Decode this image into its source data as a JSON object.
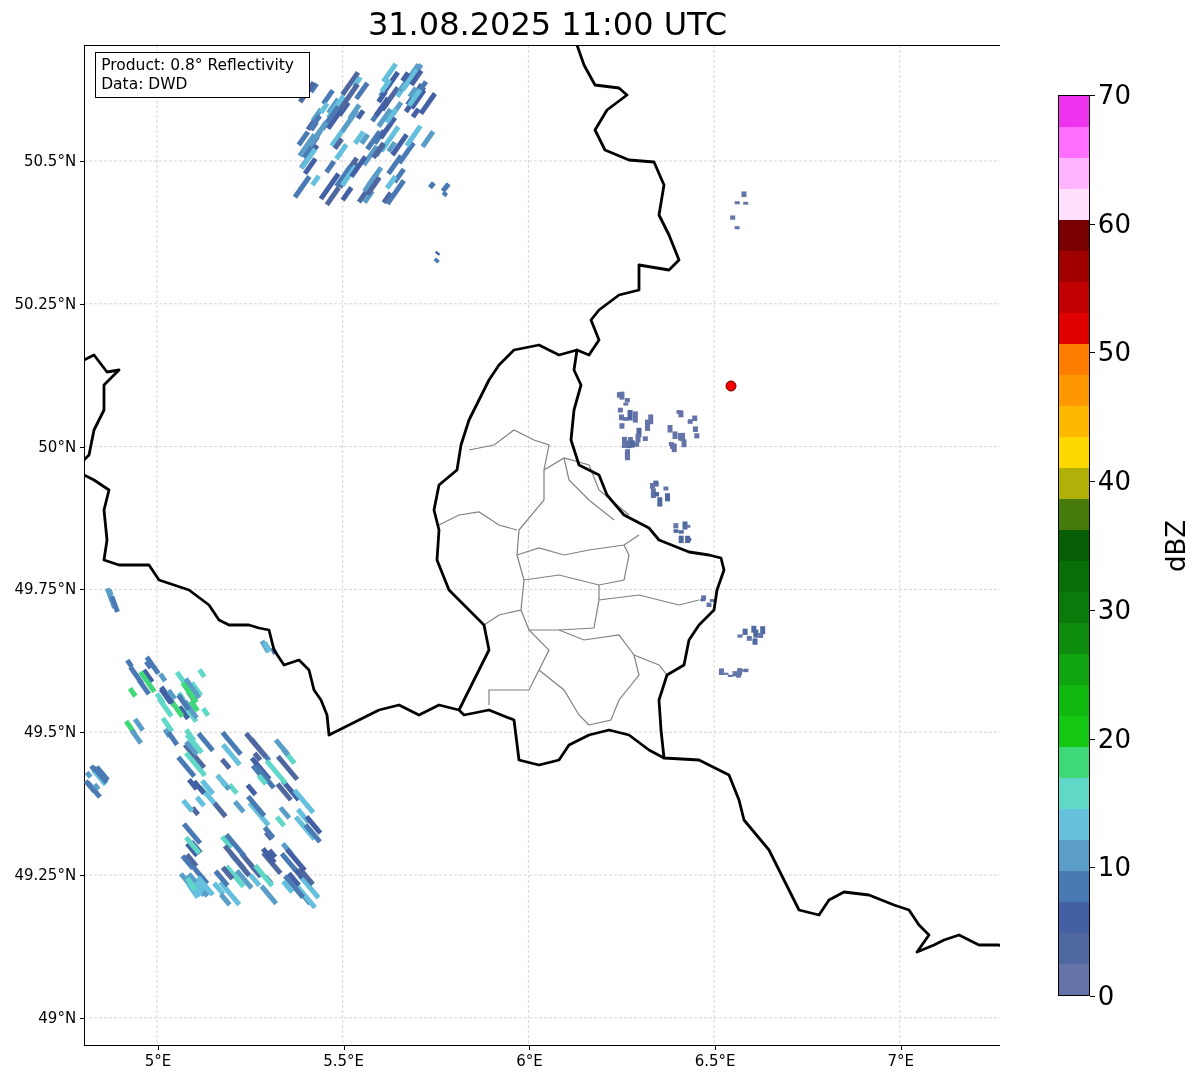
{
  "title": "31.08.2025 11:00 UTC",
  "info_box": {
    "lines": [
      "Product: 0.8° Reflectivity",
      "Data: DWD"
    ]
  },
  "map": {
    "lat_ticks": [
      "50.5°N",
      "50.25°N",
      "50°N",
      "49.75°N",
      "49.5°N",
      "49.25°N",
      "49°N"
    ],
    "lon_ticks": [
      "5°E",
      "5.5°E",
      "6°E",
      "6.5°E",
      "7°E"
    ]
  },
  "colorbar": {
    "label": "dBZ",
    "ticks": [
      "70",
      "60",
      "50",
      "40",
      "30",
      "20",
      "10",
      "0"
    ],
    "bands": [
      {
        "color": "#ee33ee"
      },
      {
        "color": "#ff6eff"
      },
      {
        "color": "#ffb4ff"
      },
      {
        "color": "#ffe0ff"
      },
      {
        "color": "#780000"
      },
      {
        "color": "#a00000"
      },
      {
        "color": "#c00000"
      },
      {
        "color": "#e00000"
      },
      {
        "color": "#ff7e00"
      },
      {
        "color": "#ff9800"
      },
      {
        "color": "#ffb800"
      },
      {
        "color": "#ffd800"
      },
      {
        "color": "#b0b008"
      },
      {
        "color": "#467a0a"
      },
      {
        "color": "#065e06"
      },
      {
        "color": "#086e08"
      },
      {
        "color": "#0a7a0a"
      },
      {
        "color": "#0e8c0e"
      },
      {
        "color": "#10a410"
      },
      {
        "color": "#10b810"
      },
      {
        "color": "#14c814"
      },
      {
        "color": "#3ed878"
      },
      {
        "color": "#60d8c8"
      },
      {
        "color": "#64c0dc"
      },
      {
        "color": "#5a9ec8"
      },
      {
        "color": "#4a7ab4"
      },
      {
        "color": "#4460a4"
      },
      {
        "color": "#5068a0"
      },
      {
        "color": "#6474a8"
      }
    ]
  }
}
